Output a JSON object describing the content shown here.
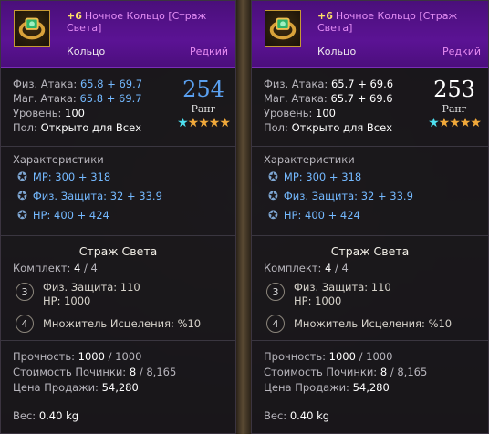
{
  "panels": [
    {
      "item": {
        "enhance": "+6",
        "name": "Ночное Кольцо [Страж Света]",
        "type": "Кольцо",
        "rarity": "Редкий"
      },
      "stats": {
        "phys_attack_label": "Физ. Атака:",
        "phys_attack_value": "65.8 + 69.7",
        "mag_attack_label": "Маг. Атака:",
        "mag_attack_value": "65.8 + 69.7",
        "level_label": "Уровень:",
        "level_value": "100",
        "gender_label": "Пол:",
        "gender_value": "Открыто для Всех"
      },
      "rank": {
        "value": "254",
        "label": "Ранг",
        "color": "#5aa0f0",
        "cyan_stars": 1,
        "gold_stars": 4
      },
      "characteristics": {
        "title": "Характеристики",
        "rows": [
          {
            "label": "MP:",
            "value": "300 + 318"
          },
          {
            "label": "Физ. Защита:",
            "value": "32 + 33.9"
          },
          {
            "label": "HP:",
            "value": "400 + 424"
          }
        ]
      },
      "set": {
        "title": "Страж Света",
        "count_label": "Комплект:",
        "count_current": "4",
        "count_total": "/ 4",
        "bonus3": {
          "num": "3",
          "line1": "Физ. Защита: 110",
          "line2": "HP: 1000"
        },
        "bonus4": {
          "num": "4",
          "line1": "Множитель Исцеления: %10"
        }
      },
      "durability": {
        "label": "Прочность:",
        "current": "1000",
        "max": "/ 1000"
      },
      "repair": {
        "label": "Стоимость Починки:",
        "current": "8",
        "max": "/ 8,165"
      },
      "price": {
        "label": "Цена Продажи:",
        "value": "54,280"
      },
      "weight": {
        "label": "Вес:",
        "value": "0.40 kg"
      }
    },
    {
      "item": {
        "enhance": "+6",
        "name": "Ночное Кольцо [Страж Света]",
        "type": "Кольцо",
        "rarity": "Редкий"
      },
      "stats": {
        "phys_attack_label": "Физ. Атака:",
        "phys_attack_value": "65.7 + 69.6",
        "mag_attack_label": "Маг. Атака:",
        "mag_attack_value": "65.7 + 69.6",
        "level_label": "Уровень:",
        "level_value": "100",
        "gender_label": "Пол:",
        "gender_value": "Открыто для Всех"
      },
      "rank": {
        "value": "253",
        "label": "Ранг",
        "color": "#ffffff",
        "cyan_stars": 1,
        "gold_stars": 4
      },
      "characteristics": {
        "title": "Характеристики",
        "rows": [
          {
            "label": "MP:",
            "value": "300 + 318"
          },
          {
            "label": "Физ. Защита:",
            "value": "32 + 33.9"
          },
          {
            "label": "HP:",
            "value": "400 + 424"
          }
        ]
      },
      "set": {
        "title": "Страж Света",
        "count_label": "Комплект:",
        "count_current": "4",
        "count_total": "/ 4",
        "bonus3": {
          "num": "3",
          "line1": "Физ. Защита: 110",
          "line2": "HP: 1000"
        },
        "bonus4": {
          "num": "4",
          "line1": "Множитель Исцеления: %10"
        }
      },
      "durability": {
        "label": "Прочность:",
        "current": "1000",
        "max": "/ 1000"
      },
      "repair": {
        "label": "Стоимость Починки:",
        "current": "8",
        "max": "/ 8,165"
      },
      "price": {
        "label": "Цена Продажи:",
        "value": "54,280"
      },
      "weight": {
        "label": "Вес:",
        "value": "0.40 kg"
      }
    }
  ]
}
